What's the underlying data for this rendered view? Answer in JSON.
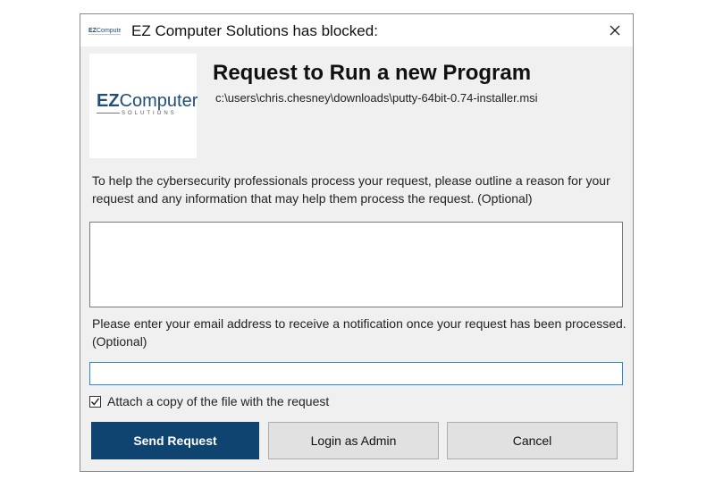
{
  "window": {
    "title": "EZ Computer Solutions has blocked:",
    "close_icon": "close-icon"
  },
  "logo": {
    "brand_ez": "EZ",
    "brand_computer": "Computer",
    "brand_sub": "SOLUTIONS",
    "colors": {
      "primary": "#1f4e79"
    }
  },
  "header": {
    "title": "Request to Run a new Program",
    "path": "c:\\users\\chris.chesney\\downloads\\putty-64bit-0.74-installer.msi"
  },
  "reason": {
    "prompt": "To help the cybersecurity professionals process your request, please outline a reason for your request and any information that may help them process the request. (Optional)",
    "value": ""
  },
  "email": {
    "prompt": "Please enter your email address to receive a notification once your request has been processed. (Optional)",
    "value": ""
  },
  "attach": {
    "label": "Attach a copy of the file with the request",
    "checked": true
  },
  "buttons": {
    "send": "Send Request",
    "login": "Login as Admin",
    "cancel": "Cancel"
  },
  "colors": {
    "primary_button": "#0f4470",
    "input_focus_border": "#2f86d1"
  }
}
